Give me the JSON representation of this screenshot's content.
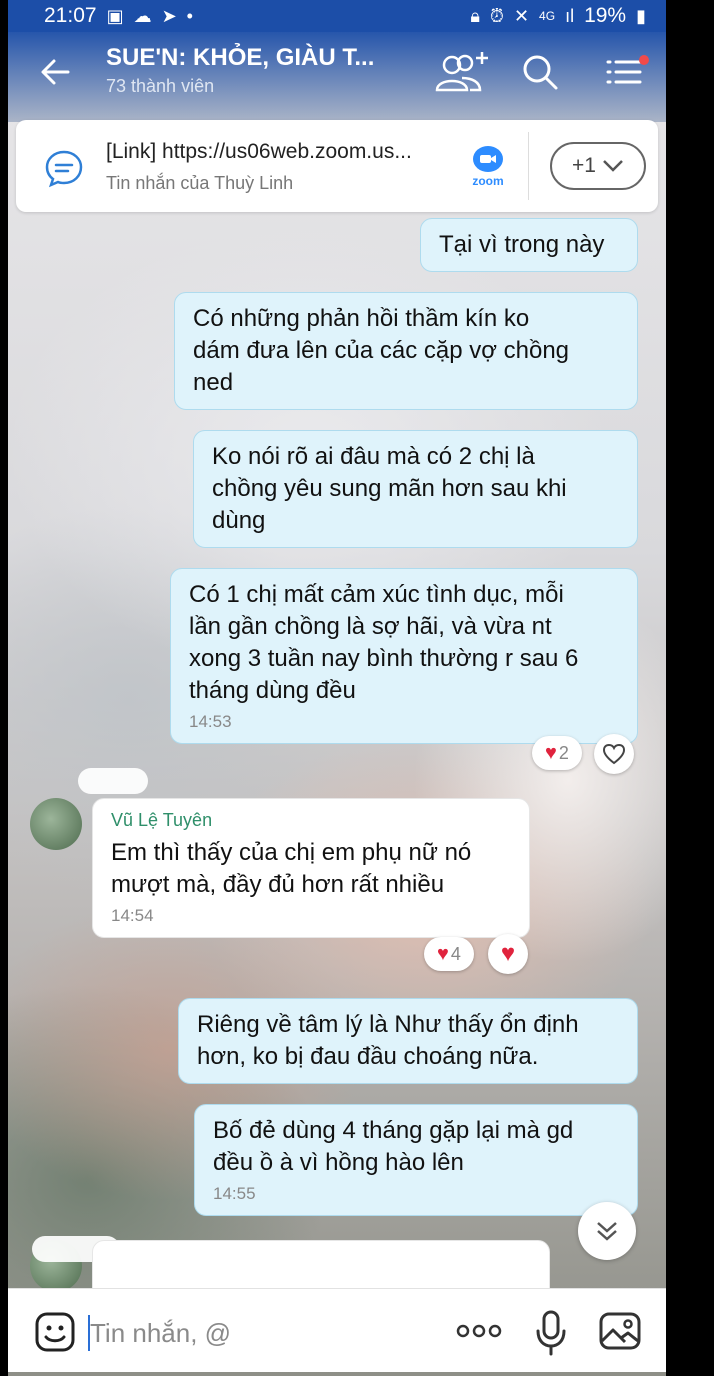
{
  "status_bar": {
    "time": "21:07",
    "network": "4G",
    "battery": "19%"
  },
  "header": {
    "title": "SUE'N: KHỎE, GIÀU T...",
    "subtitle": "73 thành viên"
  },
  "pinned": {
    "title": "[Link] https://us06web.zoom.us...",
    "subtitle": "Tin nhắn của Thuỳ Linh",
    "app_label": "zoom",
    "more_count": "+1"
  },
  "messages": [
    {
      "id": "m1",
      "direction": "out",
      "text": "Tại vì trong này"
    },
    {
      "id": "m2",
      "direction": "out",
      "lines": [
        "Có những phản hồi thầm kín ko",
        "dám đưa lên của các cặp vợ chồng",
        "ned"
      ]
    },
    {
      "id": "m3",
      "direction": "out",
      "lines": [
        "Ko nói rõ ai đâu mà có 2 chị là",
        "chồng  yêu sung mãn hơn sau khi",
        "dùng"
      ]
    },
    {
      "id": "m4",
      "direction": "out",
      "lines": [
        "Có 1 chị mất cảm xúc tình dục, mỗi",
        "lần gần chồng là sợ hãi, và vừa nt",
        "xong 3 tuần nay bình thường r sau 6",
        "tháng dùng đều"
      ],
      "time": "14:53",
      "reaction_count": "2"
    },
    {
      "id": "m5",
      "direction": "in",
      "sender": "Vũ Lệ Tuyên",
      "lines": [
        "Em thì thấy của chị em phụ nữ nó",
        "mượt mà, đầy đủ hơn rất nhiều"
      ],
      "time": "14:54",
      "reaction_count": "4"
    },
    {
      "id": "m6",
      "direction": "out",
      "lines": [
        "Riêng về tâm lý là Như thấy ổn định",
        "hơn, ko bị đau đầu choáng nữa."
      ]
    },
    {
      "id": "m7",
      "direction": "out",
      "lines": [
        "Bố đẻ dùng 4 tháng gặp lại mà gd",
        "đều ồ à vì hồng hào lên"
      ],
      "time": "14:55"
    }
  ],
  "input": {
    "placeholder": "Tin nhắn, @"
  },
  "colors": {
    "header": "#1c4ea8",
    "outgoing_bubble": "#dff3fb",
    "incoming_bubble": "#ffffff",
    "heart": "#e0233d",
    "accent": "#2d8cff"
  }
}
